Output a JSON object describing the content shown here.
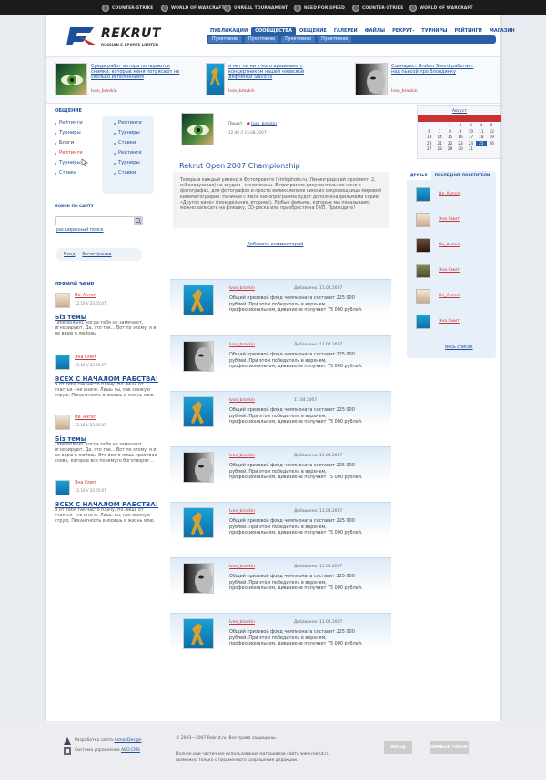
{
  "topbar": {
    "games": [
      "COUNTER-STRIKE",
      "WORLD OF WARCRAFT",
      "UNREAL TOURNAMENT",
      "NEED FOR SPEED",
      "COUNTER-STRIKE",
      "WORLD OF WARCRAFT"
    ]
  },
  "logo": {
    "word": "REKRUT",
    "tagline": "RUSSIAN E-SPORTS LIMITED"
  },
  "nav": {
    "items": [
      "ПУБЛИКАЦИИ",
      "СООБЩЕСТВА",
      "ОБЩЕНИЕ",
      "ГАЛЕРЕИ",
      "ФАЙЛЫ",
      "РЕКРУТ-ТВ",
      "ТУРНИРЫ",
      "РЕЙТИНГИ",
      "МАГАЗИН"
    ],
    "subitems": [
      "Пунктменю",
      "Пунктменю",
      "Пунктменю",
      "Пунктменю"
    ]
  },
  "feed": [
    {
      "text": "Среди работ автора попадаются снимки, которые меня потрясают не сколько исполнением",
      "author": "Ivan_brovkin"
    },
    {
      "text": "а нет ли ни у кого архивчика с концертником нашей няевской дефченки Slavicks",
      "author": "Ivan_brovkin"
    },
    {
      "text": "Сценарист Broken Sword работает над пьесой про блондинку",
      "author": "Ivan_brovkin"
    }
  ],
  "left": {
    "heading_chat": "ОБЩЕНИЕ",
    "menu_left": [
      "Рейтинги",
      "Турниры",
      "Блоги",
      "Рейтинги",
      "Турниры",
      "Ставки"
    ],
    "menu_right": [
      "Рейтинги",
      "Турниры",
      "Ставки",
      "Рейтинги",
      "Турниры",
      "Ставки"
    ],
    "search_heading": "ПОИСК ПО САЙТУ",
    "search_advanced": "расширенный поиск",
    "login": "Вход",
    "register": "Регистрация",
    "live_heading": "ПРЯМОЙ ЭФИР",
    "live": [
      {
        "name": "Не_Ангел",
        "date": "12.10 // 23.05.07",
        "title": "Бiз темы",
        "body": "Тебе больно, когда тебя не замечают, игнорируют. Да, это так... Вот по этому, я и не верю в любовь."
      },
      {
        "name": "Эна Смит",
        "date": "12.10 // 23.05.07",
        "title": "ВСЕХ С НАЧАЛОМ РАБСТВА!",
        "body": "Я от тебя так часто плачу, Но лишь от счастья - не иначе. Лишь ты, как свежую струю, Пикантность вносишь в жизнь мою."
      },
      {
        "name": "Не_Ангел",
        "date": "12.10 // 23.05.07",
        "title": "Бiз темы",
        "body": "Тебе больно, когда тебя не замечают, игнорируют. Да, это так... Вот по этому, я и не верю в любовь. Это всего лишь красивое слово, которое все понемуто боготворят..."
      },
      {
        "name": "Эна Смит",
        "date": "12.10 // 23.05.07",
        "title": "ВСЕХ С НАЧАЛОМ РАБСТВА!",
        "body": "Я от тебя так часто плачу, Но лишь от счастья - не иначе. Лишь ты, как свежую струю, Пикантность вносишь в жизнь мою."
      }
    ]
  },
  "article": {
    "meta_label": "Пишет",
    "meta_author": "Ivan_brovkin",
    "date": "12:46 // 15.08.2007",
    "title": "Rekrut Open 2007 Championship",
    "body": "Теперь в каждый уикенд в Фотопроекте (hmfaphoto.ru, Ленинградский проспект, 2, м.Белорусская) на студии - кинопоказы. В программе документальное кино о фотографах, для фотографов и просто великолепное кино из сокровищницы мировой кинематографии. Начиная с июля кинопрограмма будет дополнена фильмами серии «Другое кино» (понедельник, вторник). Любые фильмы, которые мы показываем, можно записать на флешку, CD-диски или приобрести на DVD. Приходите!",
    "add_comment": "Добавить комментарий"
  },
  "comments": [
    {
      "author": "Ivan_brovkin",
      "date": "Добавлено: 11.04.2007",
      "text": "Общий призовой фонд чемпионата составит 225 000 рублей. При этом победитель в верхнем, профессиональном, дивизионе получает 75 000 рублей.",
      "photo": "blue"
    },
    {
      "author": "Ivan_brovkin",
      "date": "Добавлено: 11.04.2007",
      "text": "Общий призовой фонд чемпионата составит 225 000 рублей. При этом победитель в верхнем, профессиональном, дивизионе получает 75 000 рублей.",
      "photo": "bw"
    },
    {
      "author": "Ivan_brovkin",
      "date": "11.04.2007",
      "text": "Общий призовой фонд чемпионата составит 225 000 рублей. При этом победитель в верхнем, профессиональном, дивизионе получает 75 000 рублей.",
      "photo": "blue"
    },
    {
      "author": "Ivan_brovkin",
      "date": "Добавлено: 11.04.2007",
      "text": "Общий призовой фонд чемпионата составит 225 000 рублей. При этом победитель в верхнем, профессиональном, дивизионе получает 75 000 рублей.",
      "photo": "bw"
    },
    {
      "author": "Ivan_brovkin",
      "date": "Добавлено: 11.04.2007",
      "text": "Общий призовой фонд чемпионата составит 225 000 рублей. При этом победитель в верхнем, профессиональном, дивизионе получает 75 000 рублей.",
      "photo": "blue"
    },
    {
      "author": "Ivan_brovkin",
      "date": "Добавлено: 11.04.2007",
      "text": "Общий призовой фонд чемпионата составит 225 000 рублей. При этом победитель в верхнем, профессиональном, дивизионе получает 75 000 рублей.",
      "photo": "bw"
    },
    {
      "author": "Ivan_brovkin",
      "date": "Добавлено: 11.04.2007",
      "text": "Общий призовой фонд чемпионата составит 225 000 рублей. При этом победитель в верхнем, профессиональном, дивизионе получает 75 000 рублей.",
      "photo": "blue"
    }
  ],
  "calendar": {
    "month": "Август",
    "weekdays": [
      "",
      "",
      "",
      "",
      "",
      "",
      ""
    ],
    "days": [
      "",
      "",
      "1",
      "2",
      "3",
      "4",
      "5",
      "6",
      "7",
      "8",
      "9",
      "10",
      "11",
      "12",
      "13",
      "14",
      "15",
      "16",
      "17",
      "18",
      "19",
      "20",
      "21",
      "22",
      "23",
      "24",
      "25",
      "26",
      "27",
      "28",
      "29",
      "30",
      "31",
      "",
      ""
    ],
    "today": "25"
  },
  "friends": {
    "tab_friends": "ДРУЗЬЯ",
    "tab_visitors": "ПОСЛЕДНИЕ ПОСЕТИТЕЛИ",
    "list": [
      "Не_Ангел",
      "Эна Смит",
      "Не_Ангел",
      "Эна Смит",
      "Не_Ангел",
      "Эна Смит"
    ],
    "all": "Весь список"
  },
  "footer": {
    "dev_label": "Разработка сайта",
    "dev_link": "ArmoxDesign",
    "cms_label": "Система управления",
    "cms_link": "ABO.CMS",
    "copyright": "© 2003—2007 Rekrut.ru. Все права защищены.",
    "legal": "Полное или частичное использование материалов сайта www.rekrut.ru возможно только с письменного разрешения редакции.",
    "badge1": "HotLog",
    "badge2": "RAMBLER TOP100"
  },
  "colors": {
    "accent": "#1e4f9a",
    "red": "#c93232"
  }
}
